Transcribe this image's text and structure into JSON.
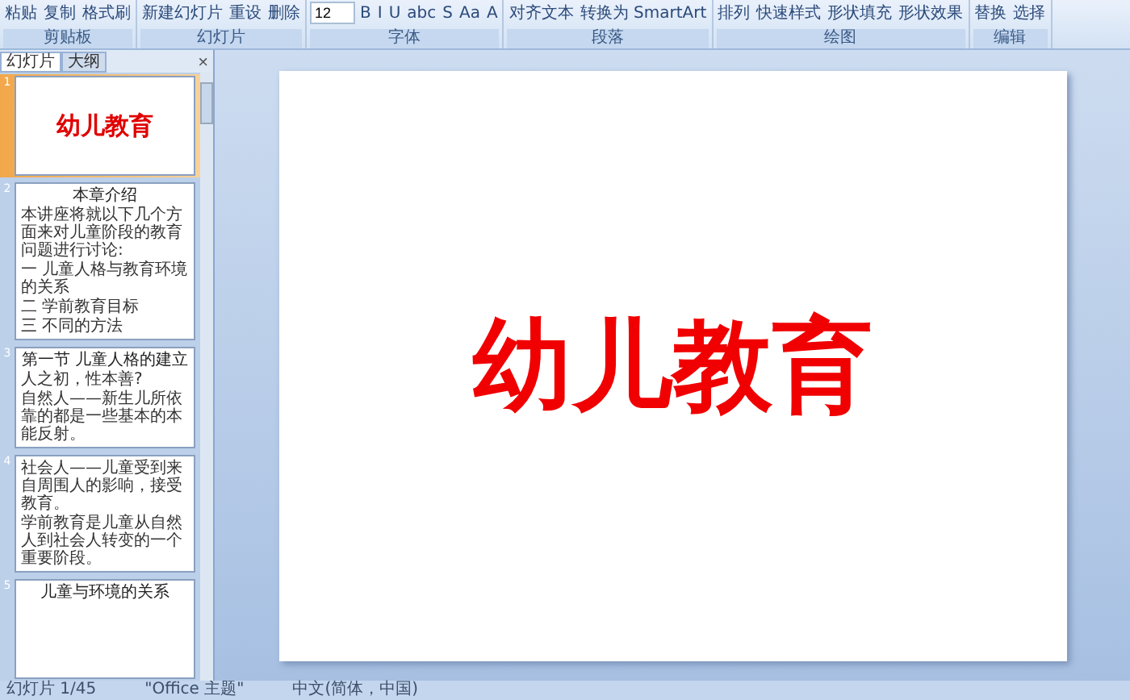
{
  "ribbon": {
    "font_size": "12",
    "groups": [
      {
        "label": "剪贴板",
        "buttons": [
          "粘贴",
          "复制",
          "格式刷"
        ]
      },
      {
        "label": "幻灯片",
        "buttons": [
          "新建幻灯片",
          "重设",
          "删除"
        ]
      },
      {
        "label": "字体",
        "buttons": [
          "B",
          "I",
          "U",
          "abc",
          "S",
          "Aa",
          "A"
        ]
      },
      {
        "label": "段落",
        "buttons": [
          "对齐文本",
          "转换为 SmartArt"
        ]
      },
      {
        "label": "绘图",
        "buttons": [
          "排列",
          "快速样式",
          "形状填充",
          "形状效果"
        ]
      },
      {
        "label": "编辑",
        "buttons": [
          "替换",
          "选择"
        ]
      }
    ]
  },
  "pane": {
    "tabs": [
      {
        "label": "幻灯片",
        "selected": true
      },
      {
        "label": "大纲",
        "selected": false
      }
    ],
    "close": "×"
  },
  "slides": [
    {
      "number": "1",
      "selected": true,
      "kind": "title",
      "title": "幼儿教育"
    },
    {
      "number": "2",
      "selected": false,
      "kind": "content",
      "title": "本章介绍",
      "bullets": [
        "本讲座将就以下几个方面来对儿童阶段的教育问题进行讨论:",
        "一 儿童人格与教育环境的关系",
        "二 学前教育目标",
        "三 不同的方法"
      ]
    },
    {
      "number": "3",
      "selected": false,
      "kind": "content",
      "title": "第一节 儿童人格的建立",
      "bullets": [
        "人之初，性本善?",
        "自然人——新生儿所依靠的都是一些基本的本能反射。"
      ]
    },
    {
      "number": "4",
      "selected": false,
      "kind": "content",
      "bullets": [
        "社会人——儿童受到来自周围人的影响，接受教育。",
        "学前教育是儿童从自然人到社会人转变的一个重要阶段。"
      ]
    },
    {
      "number": "5",
      "selected": false,
      "kind": "content",
      "title": "儿童与环境的关系"
    }
  ],
  "main_slide": {
    "title": "幼儿教育"
  },
  "status_bar": [
    "幻灯片 1/45",
    "\"Office 主题\"",
    "中文(简体，中国)"
  ]
}
